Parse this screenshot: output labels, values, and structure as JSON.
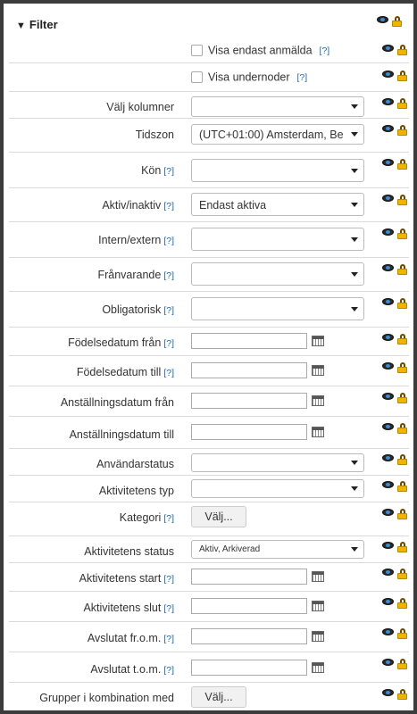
{
  "filter": {
    "title": "Filter"
  },
  "help": "[?]",
  "checkboxes": [
    {
      "label": "Visa endast anmälda",
      "checked": false
    },
    {
      "label": "Visa undernoder",
      "checked": false
    }
  ],
  "rows": {
    "valj_kolumner": {
      "label": "Välj kolumner",
      "value": ""
    },
    "tidszon": {
      "label": "Tidszon",
      "value": "(UTC+01:00) Amsterdam, Be"
    },
    "kon": {
      "label": "Kön",
      "value": ""
    },
    "aktiv_inaktiv": {
      "label": "Aktiv/inaktiv",
      "value": "Endast aktiva"
    },
    "intern_extern": {
      "label": "Intern/extern",
      "value": ""
    },
    "franvarande": {
      "label": "Frånvarande",
      "value": ""
    },
    "obligatorisk": {
      "label": "Obligatorisk",
      "value": ""
    },
    "fodelsedatum_fran": {
      "label": "Födelsedatum från"
    },
    "fodelsedatum_till": {
      "label": "Födelsedatum till"
    },
    "anstallningsdatum_fran": {
      "label": "Anställningsdatum från"
    },
    "anstallningsdatum_till": {
      "label": "Anställningsdatum till"
    },
    "anvandarstatus": {
      "label": "Användarstatus",
      "value": ""
    },
    "aktivitetens_typ": {
      "label": "Aktivitetens typ",
      "value": ""
    },
    "kategori": {
      "label": "Kategori",
      "button": "Välj..."
    },
    "aktivitetens_status": {
      "label": "Aktivitetens status",
      "value": "Aktiv, Arkiverad"
    },
    "aktivitetens_start": {
      "label": "Aktivitetens start"
    },
    "aktivitetens_slut": {
      "label": "Aktivitetens slut"
    },
    "avslutat_from": {
      "label": "Avslutat fr.o.m."
    },
    "avslutat_tom": {
      "label": "Avslutat t.o.m."
    },
    "grupper": {
      "label": "Grupper i kombination med",
      "button": "Välj..."
    }
  },
  "icons": {
    "visibility": "eye-icon",
    "lock": "lock-icon",
    "filter": "funnel-icon"
  }
}
